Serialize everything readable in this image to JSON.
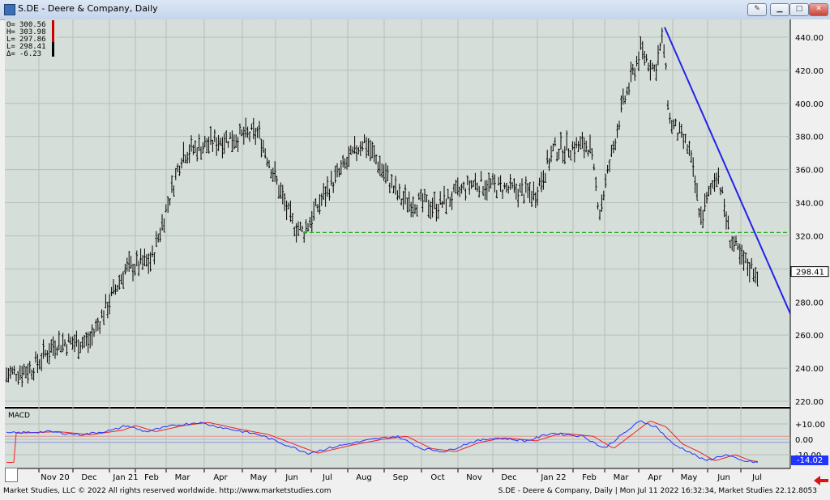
{
  "window": {
    "title": "S.DE - Deere & Company, Daily",
    "buttons": [
      "tool",
      "min",
      "max",
      "close"
    ]
  },
  "ohlc_box": {
    "rows": [
      {
        "label": "O=",
        "value": "300.56"
      },
      {
        "label": "H=",
        "value": "303.98"
      },
      {
        "label": "L=",
        "value": "297.86"
      },
      {
        "label": "L=",
        "value": "298.41"
      },
      {
        "label": "Δ=",
        "value": "-6.23"
      }
    ]
  },
  "price_panel": {
    "y_ticks": [
      "440.00",
      "420.00",
      "400.00",
      "380.00",
      "360.00",
      "340.00",
      "320.00",
      "300.00",
      "280.00",
      "260.00",
      "240.00",
      "220.00"
    ],
    "last_price_label": "298.41",
    "last_price_value": 298.41,
    "support_level": 322,
    "trendline": {
      "from": {
        "date": "Apr 2022",
        "price": 446
      },
      "to": {
        "date": "Jul 2022",
        "price": 273
      }
    }
  },
  "macd_panel": {
    "label": "MACD",
    "y_ticks": [
      "+10.00",
      "0.00",
      "-10.00"
    ],
    "last_value_label": "-14.02"
  },
  "x_axis": {
    "labels": [
      "Nov 20",
      "Dec",
      "Jan 21",
      "Feb",
      "Mar",
      "Apr",
      "May",
      "Jun",
      "Jul",
      "Aug",
      "Sep",
      "Oct",
      "Nov",
      "Dec",
      "Jan 22",
      "Feb",
      "Mar",
      "Apr",
      "May",
      "Jun",
      "Jul"
    ]
  },
  "colors": {
    "chart_bg": "#d6ded9",
    "grid": "#b7bfbb",
    "bar": "#000000",
    "trendline": "#2222ee",
    "support": "#22aa22",
    "macd_line": "#2233ff",
    "signal_line": "#ee2222"
  },
  "chart_data": {
    "type": "line",
    "title": "S.DE - Deere & Company, Daily",
    "x": [
      "Nov 20",
      "Dec",
      "Jan 21",
      "Feb",
      "Mar",
      "Apr",
      "May",
      "Jun",
      "Jul",
      "Aug",
      "Sep",
      "Oct",
      "Nov",
      "Dec",
      "Jan 22",
      "Feb",
      "Mar",
      "Apr",
      "May",
      "Jun",
      "Jul"
    ],
    "series": [
      {
        "name": "",
        "values": [
          255,
          268,
          300,
          305,
          370,
          378,
          380,
          322,
          345,
          378,
          340,
          340,
          355,
          348,
          372,
          375,
          425,
          420,
          370,
          342,
          298
        ]
      }
    ],
    "ylim": [
      220,
      450
    ],
    "xlabel": "",
    "ylabel": "",
    "grid": true
  },
  "status": {
    "left": "Market Studies, LLC © 2022 All rights reserved worldwide. http://www.marketstudies.com",
    "right": "S.DE - Deere & Company, Daily | Mon Jul 11 2022 16:32:34, Market Studies 22.12.8053"
  }
}
